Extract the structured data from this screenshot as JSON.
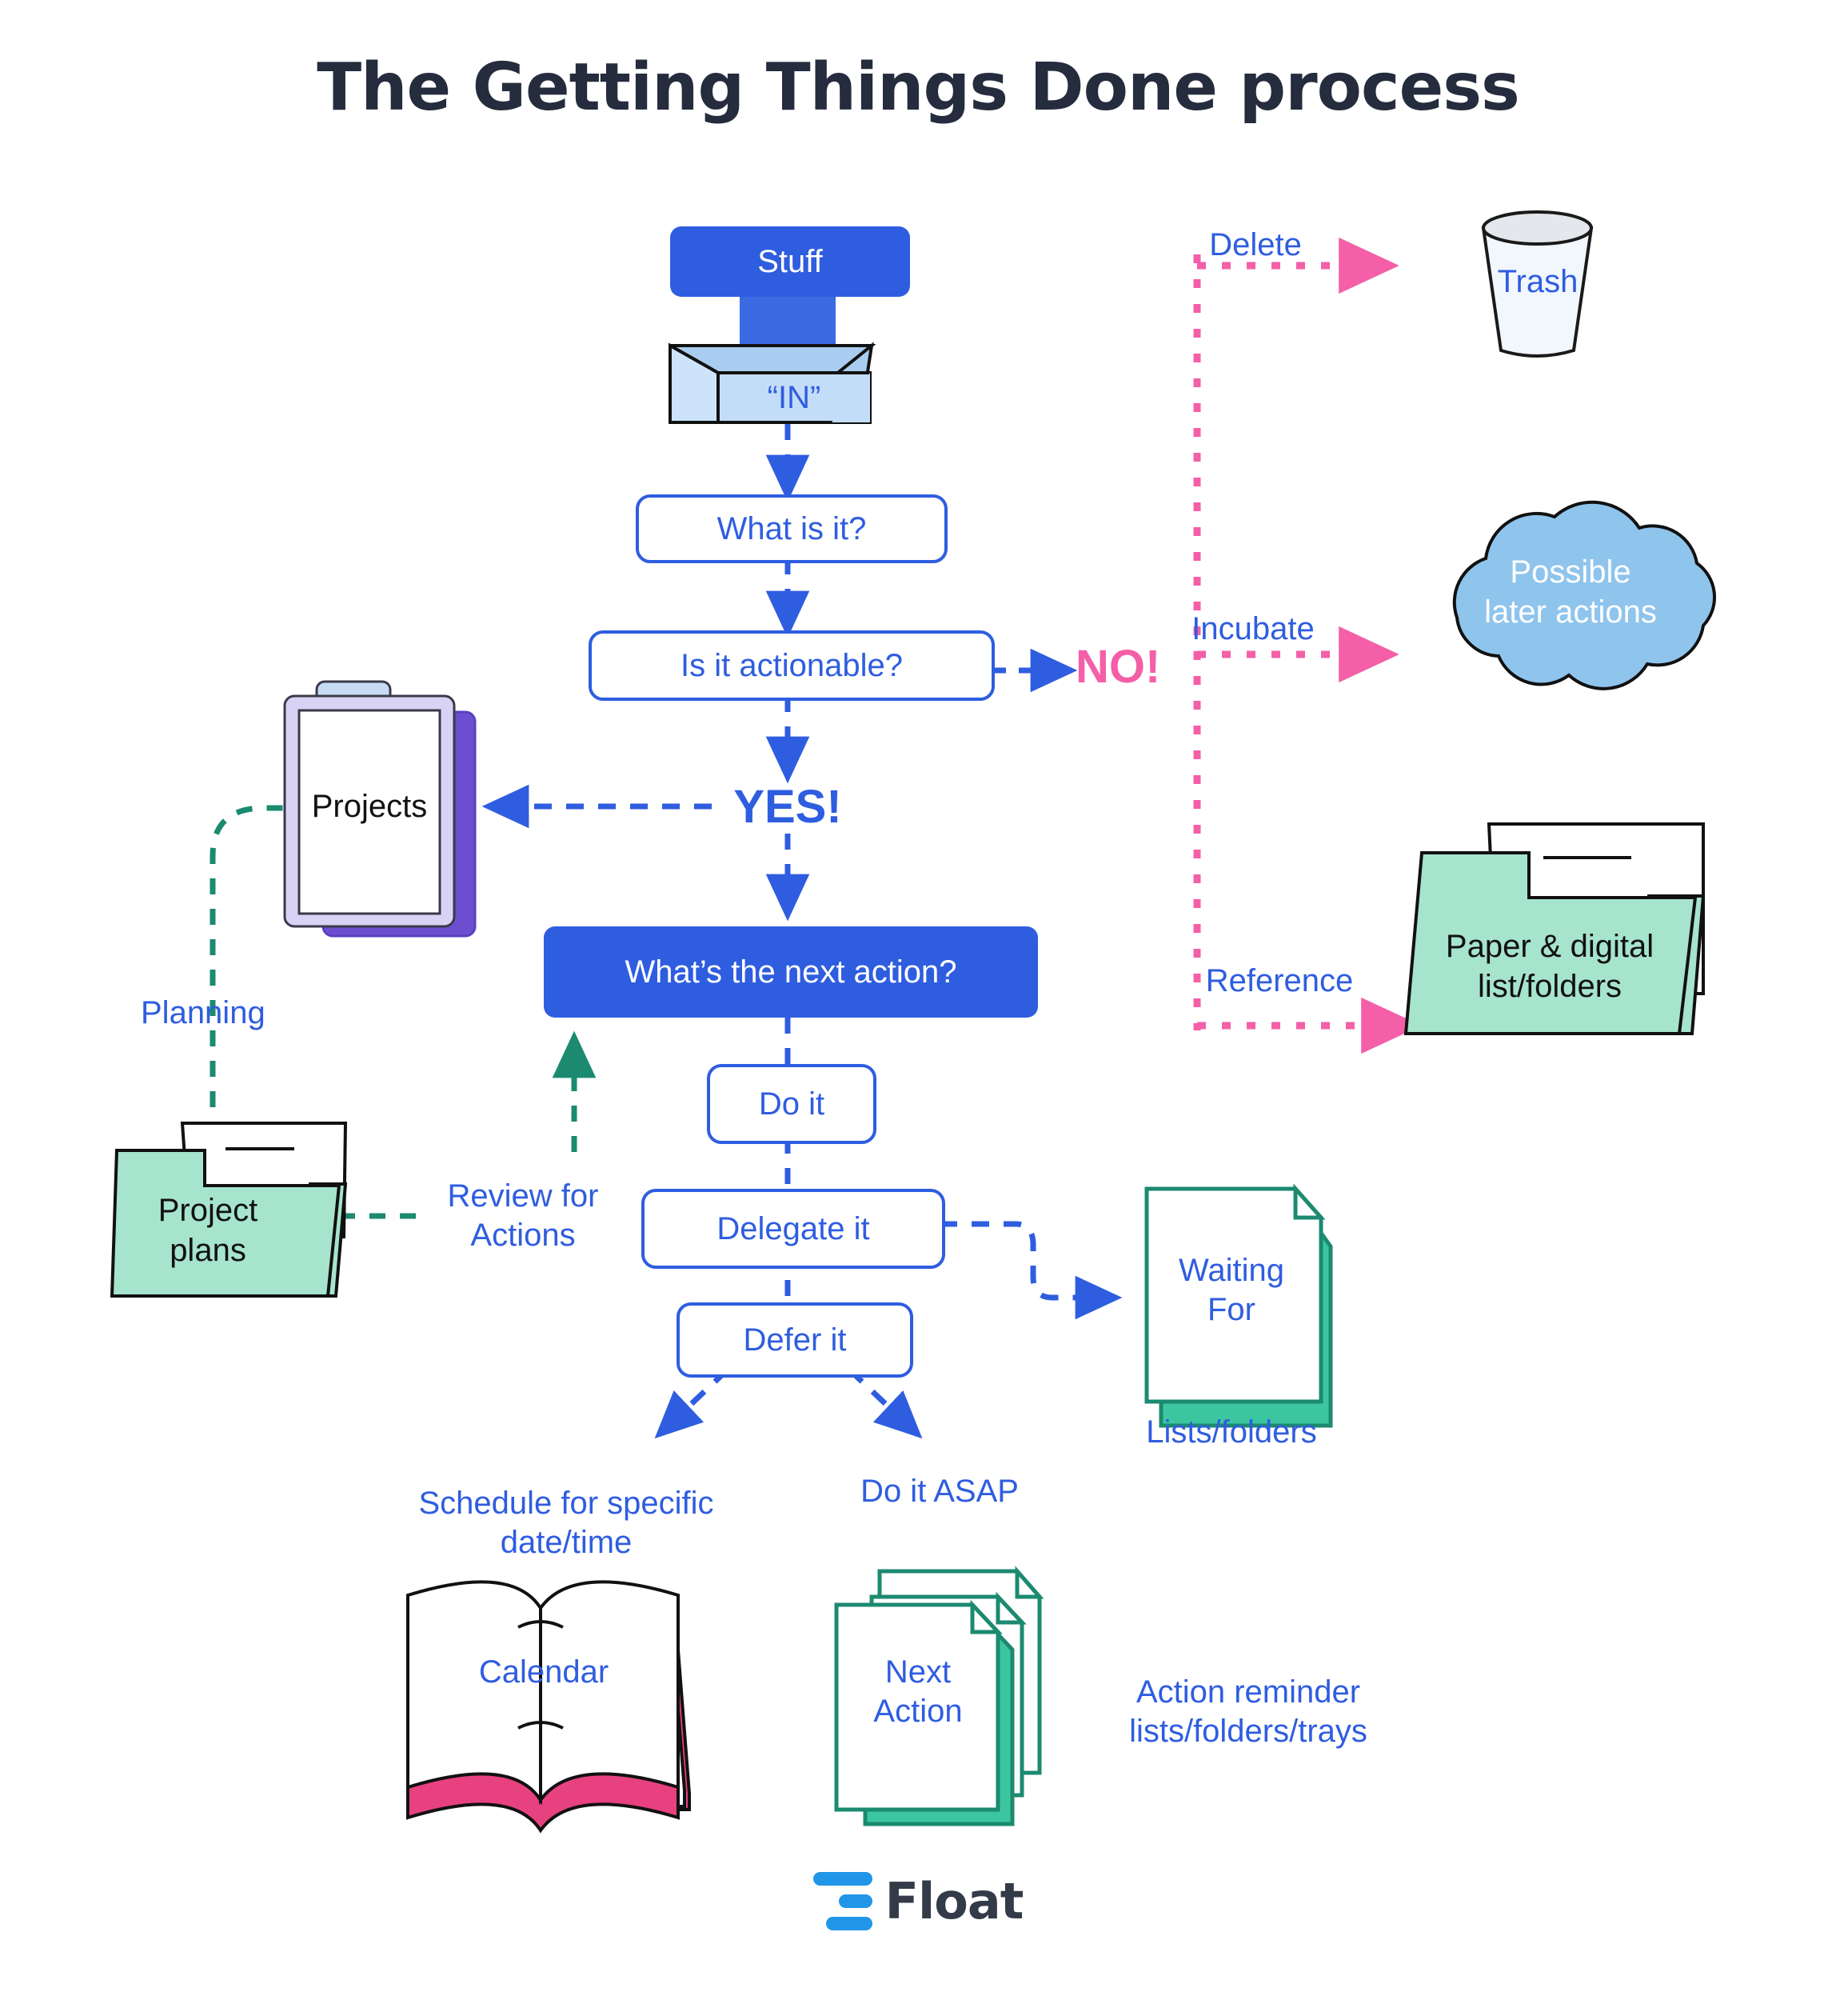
{
  "page": {
    "title": "The Getting Things Done process",
    "background_color": "#ffffff"
  },
  "colors": {
    "blue": "#2f5de0",
    "pink": "#f45fa8",
    "teal": "#1b8a70",
    "mint": "#a6e4cd",
    "cloud_blue": "#8fc4ec",
    "in_box_blue": "#c3ddf8",
    "purple": "#6b4fd0",
    "lavender": "#d8d3f5",
    "navy": "#242c3d",
    "logo_blue": "#2196e8"
  },
  "nodes": {
    "stuff": "Stuff",
    "in_box": "“IN”",
    "what_is_it": "What is it?",
    "is_it_actionable": "Is it actionable?",
    "no": "NO!",
    "yes": "YES!",
    "projects": "Projects",
    "project_plans": "Project\nplans",
    "next_action_question": "What’s the next action?",
    "do_it": "Do it",
    "delegate_it": "Delegate it",
    "defer_it": "Defer it",
    "trash": "Trash",
    "possible_later_actions": "Possible\nlater actions",
    "paper_digital": "Paper & digital\nlist/folders",
    "waiting_for": "Waiting\nFor",
    "calendar": "Calendar",
    "next_action": "Next\nAction"
  },
  "edge_labels": {
    "delete": "Delete",
    "incubate": "Incubate",
    "reference": "Reference",
    "planning": "Planning",
    "review_for_actions": "Review for\nActions"
  },
  "captions": {
    "schedule": "Schedule for specific\ndate/time",
    "do_it_asap": "Do it ASAP",
    "lists_folders": "Lists/folders",
    "action_reminder": "Action reminder\nlists/folders/trays"
  },
  "footer": {
    "brand": "Float"
  }
}
